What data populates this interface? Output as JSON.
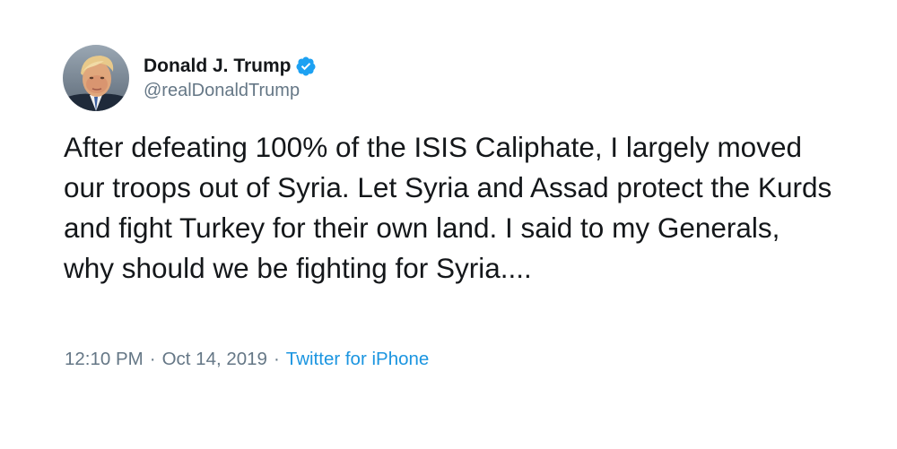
{
  "tweet": {
    "author": {
      "display_name": "Donald J. Trump",
      "handle": "@realDonaldTrump",
      "verified": true,
      "avatar_icon": "profile-photo"
    },
    "text": "After defeating 100% of the ISIS Caliphate, I largely moved our troops out of Syria. Let Syria and Assad protect the Kurds and fight Turkey for their own land. I said to my Generals, why should we be fighting for Syria....",
    "time": "12:10 PM",
    "date": "Oct 14, 2019",
    "separator": "·",
    "source": "Twitter for iPhone"
  },
  "colors": {
    "text": "#14171a",
    "secondary": "#657786",
    "link": "#1b95e0",
    "verified_badge": "#1da1f2"
  }
}
